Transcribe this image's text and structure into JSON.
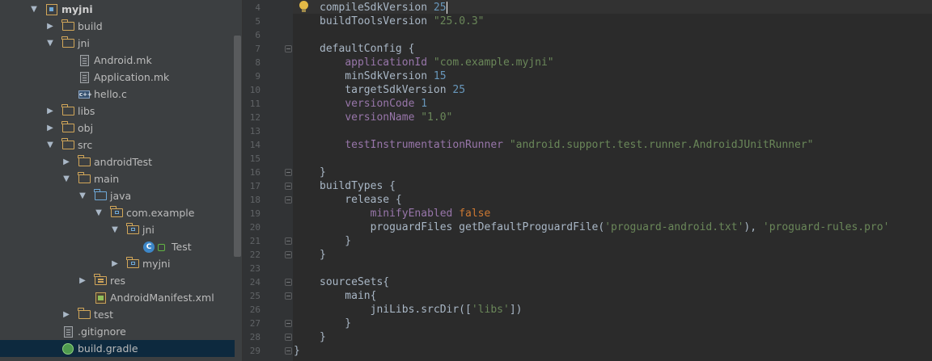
{
  "project_tree": {
    "items": [
      {
        "label": "myjni",
        "icon": "module-icon",
        "arrow": "down",
        "bold": true
      },
      {
        "label": "build",
        "icon": "folder-icon",
        "arrow": "right"
      },
      {
        "label": "jni",
        "icon": "folder-icon",
        "arrow": "down"
      },
      {
        "label": "Android.mk",
        "icon": "file-icon",
        "arrow": "none"
      },
      {
        "label": "Application.mk",
        "icon": "file-icon",
        "arrow": "none"
      },
      {
        "label": "hello.c",
        "icon": "c-file-icon",
        "arrow": "none"
      },
      {
        "label": "libs",
        "icon": "folder-icon",
        "arrow": "right"
      },
      {
        "label": "obj",
        "icon": "folder-icon",
        "arrow": "right"
      },
      {
        "label": "src",
        "icon": "folder-icon",
        "arrow": "down"
      },
      {
        "label": "androidTest",
        "icon": "folder-icon",
        "arrow": "right"
      },
      {
        "label": "main",
        "icon": "folder-icon",
        "arrow": "down"
      },
      {
        "label": "java",
        "icon": "source-folder-icon",
        "arrow": "down"
      },
      {
        "label": "com.example",
        "icon": "package-icon",
        "arrow": "down"
      },
      {
        "label": "jni",
        "icon": "package-icon",
        "arrow": "down"
      },
      {
        "label": "Test",
        "icon": "class-icon",
        "arrow": "none"
      },
      {
        "label": "myjni",
        "icon": "package-icon",
        "arrow": "right"
      },
      {
        "label": "res",
        "icon": "res-folder-icon",
        "arrow": "right"
      },
      {
        "label": "AndroidManifest.xml",
        "icon": "xml-file-icon",
        "arrow": "none"
      },
      {
        "label": "test",
        "icon": "folder-icon",
        "arrow": "right"
      },
      {
        "label": ".gitignore",
        "icon": "file-icon",
        "arrow": "none"
      },
      {
        "label": "build.gradle",
        "icon": "gradle-icon",
        "arrow": "none",
        "selected": true
      }
    ],
    "class_badge": "C"
  },
  "editor": {
    "lines": [
      {
        "n": "4",
        "tokens": [
          [
            "compileSdkVersion ",
            "plain"
          ],
          [
            "25",
            "num"
          ]
        ]
      },
      {
        "n": "5",
        "tokens": [
          [
            "buildToolsVersion ",
            "plain"
          ],
          [
            "\"25.0.3\"",
            "str"
          ]
        ]
      },
      {
        "n": "6",
        "tokens": []
      },
      {
        "n": "7",
        "tokens": [
          [
            "defaultConfig {",
            "plain"
          ]
        ]
      },
      {
        "n": "8",
        "tokens": [
          [
            "    ",
            "plain"
          ],
          [
            "applicationId",
            "prop"
          ],
          [
            " ",
            "plain"
          ],
          [
            "\"com.example.myjni\"",
            "str"
          ]
        ]
      },
      {
        "n": "9",
        "tokens": [
          [
            "    minSdkVersion ",
            "plain"
          ],
          [
            "15",
            "num"
          ]
        ]
      },
      {
        "n": "10",
        "tokens": [
          [
            "    targetSdkVersion ",
            "plain"
          ],
          [
            "25",
            "num"
          ]
        ]
      },
      {
        "n": "11",
        "tokens": [
          [
            "    ",
            "plain"
          ],
          [
            "versionCode",
            "prop"
          ],
          [
            " ",
            "plain"
          ],
          [
            "1",
            "num"
          ]
        ]
      },
      {
        "n": "12",
        "tokens": [
          [
            "    ",
            "plain"
          ],
          [
            "versionName",
            "prop"
          ],
          [
            " ",
            "plain"
          ],
          [
            "\"1.0\"",
            "str"
          ]
        ]
      },
      {
        "n": "13",
        "tokens": []
      },
      {
        "n": "14",
        "tokens": [
          [
            "    ",
            "plain"
          ],
          [
            "testInstrumentationRunner",
            "prop"
          ],
          [
            " ",
            "plain"
          ],
          [
            "\"android.support.test.runner.AndroidJUnitRunner\"",
            "str"
          ]
        ]
      },
      {
        "n": "15",
        "tokens": []
      },
      {
        "n": "16",
        "tokens": [
          [
            "}",
            "plain"
          ]
        ]
      },
      {
        "n": "17",
        "tokens": [
          [
            "buildTypes {",
            "plain"
          ]
        ]
      },
      {
        "n": "18",
        "tokens": [
          [
            "    release {",
            "plain"
          ]
        ]
      },
      {
        "n": "19",
        "tokens": [
          [
            "        ",
            "plain"
          ],
          [
            "minifyEnabled",
            "prop"
          ],
          [
            " ",
            "plain"
          ],
          [
            "false",
            "kw"
          ]
        ]
      },
      {
        "n": "20",
        "tokens": [
          [
            "        proguardFiles getDefaultProguardFile(",
            "plain"
          ],
          [
            "'proguard-android.txt'",
            "str"
          ],
          [
            "), ",
            "plain"
          ],
          [
            "'proguard-rules.pro'",
            "str"
          ]
        ]
      },
      {
        "n": "21",
        "tokens": [
          [
            "    }",
            "plain"
          ]
        ]
      },
      {
        "n": "22",
        "tokens": [
          [
            "}",
            "plain"
          ]
        ]
      },
      {
        "n": "23",
        "tokens": []
      },
      {
        "n": "24",
        "tokens": [
          [
            "sourceSets{",
            "plain"
          ]
        ]
      },
      {
        "n": "25",
        "tokens": [
          [
            "    main{",
            "plain"
          ]
        ]
      },
      {
        "n": "26",
        "tokens": [
          [
            "        jniLibs.srcDir([",
            "plain"
          ],
          [
            "'libs'",
            "str"
          ],
          [
            "])",
            "plain"
          ]
        ]
      },
      {
        "n": "27",
        "tokens": [
          [
            "    }",
            "plain"
          ]
        ]
      },
      {
        "n": "28",
        "tokens": [
          [
            "}",
            "plain"
          ]
        ]
      },
      {
        "n": "29",
        "tokens": [
          [
            "}",
            "plain"
          ]
        ]
      }
    ],
    "colors": {
      "plain": "#a9b7c6",
      "str": "#6a8759",
      "num": "#6897bb",
      "kw": "#cc7832",
      "prop": "#9876aa"
    }
  }
}
